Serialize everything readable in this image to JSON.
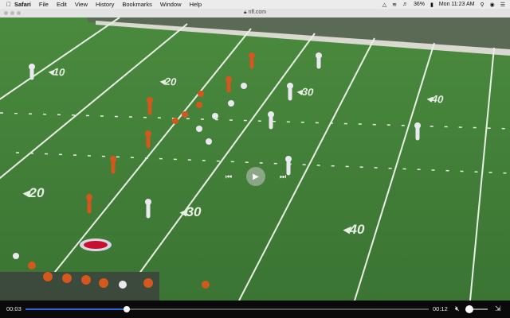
{
  "menubar": {
    "apple_icon": "apple-logo-icon",
    "app_name": "Safari",
    "menus": [
      "File",
      "Edit",
      "View",
      "History",
      "Bookmarks",
      "Window",
      "Help"
    ],
    "battery": "36%",
    "clock": "Mon 11:23 AM"
  },
  "browser": {
    "url": "nfl.com"
  },
  "field": {
    "yard_numbers": [
      "10",
      "20",
      "30",
      "40",
      "20",
      "30",
      "40"
    ],
    "colors": {
      "grass": "#3f7a36",
      "lines": "#e8efe4",
      "home": "#d2581e",
      "away": "#e9e9ef"
    }
  },
  "player": {
    "current_time": "00:03",
    "end_time": "00:12",
    "progress": 0.25,
    "volume": 0.1,
    "play_icon": "play-icon",
    "skip_back_icon": "skip-back-icon",
    "skip_forward_icon": "skip-forward-icon"
  }
}
